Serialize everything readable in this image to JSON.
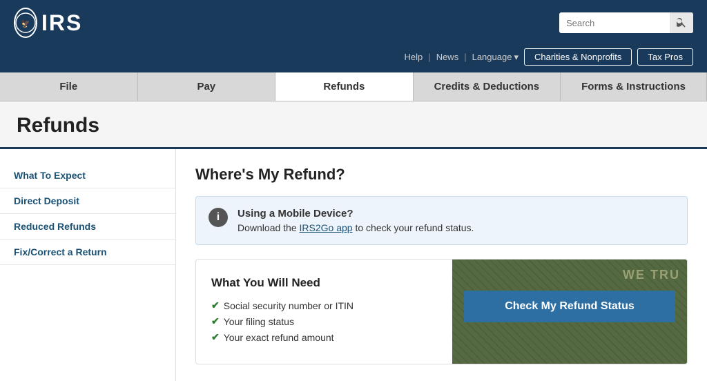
{
  "header": {
    "logo_text": "IRS",
    "logo_emblem": "🦅",
    "search_placeholder": "Search"
  },
  "utility_nav": {
    "help": "Help",
    "news": "News",
    "language": "Language",
    "charities_btn": "Charities & Nonprofits",
    "tax_pros_btn": "Tax Pros"
  },
  "main_nav": {
    "items": [
      {
        "label": "File",
        "active": false
      },
      {
        "label": "Pay",
        "active": false
      },
      {
        "label": "Refunds",
        "active": true
      },
      {
        "label": "Credits & Deductions",
        "active": false
      },
      {
        "label": "Forms & Instructions",
        "active": false
      }
    ]
  },
  "page": {
    "title": "Refunds"
  },
  "sidebar": {
    "items": [
      {
        "label": "What To Expect"
      },
      {
        "label": "Direct Deposit"
      },
      {
        "label": "Reduced Refunds"
      },
      {
        "label": "Fix/Correct a Return"
      }
    ]
  },
  "main_content": {
    "section_title": "Where's My Refund?",
    "info_box": {
      "heading": "Using a Mobile Device?",
      "text_before": "Download the ",
      "link_text": "IRS2Go app",
      "text_after": " to check your refund status."
    },
    "refund_card": {
      "title": "What You Will Need",
      "checklist": [
        "Social security number or ITIN",
        "Your filing status",
        "Your exact refund amount"
      ],
      "cta_button": "Check My Refund Status",
      "bill_text": "WE TRU"
    }
  }
}
